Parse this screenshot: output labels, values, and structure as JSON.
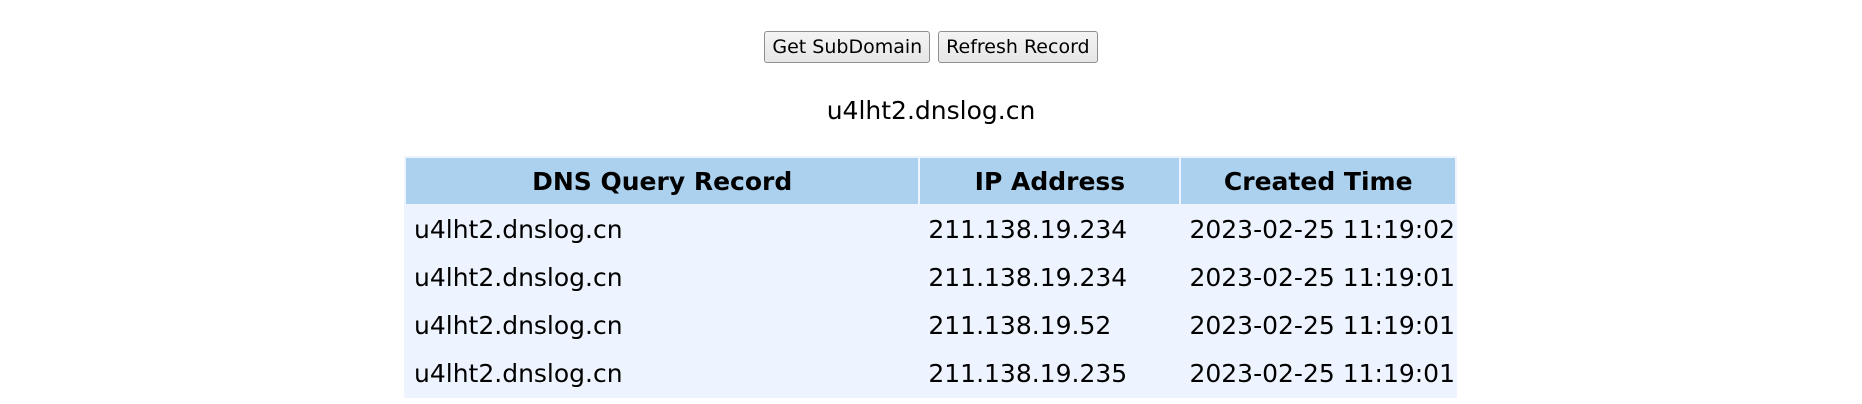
{
  "toolbar": {
    "get_subdomain_label": "Get SubDomain",
    "refresh_record_label": "Refresh Record"
  },
  "subdomain": "u4lht2.dnslog.cn",
  "table": {
    "headers": [
      "DNS Query Record",
      "IP Address",
      "Created Time"
    ],
    "rows": [
      [
        "u4lht2.dnslog.cn",
        "211.138.19.234",
        "2023-02-25 11:19:02"
      ],
      [
        "u4lht2.dnslog.cn",
        "211.138.19.234",
        "2023-02-25 11:19:01"
      ],
      [
        "u4lht2.dnslog.cn",
        "211.138.19.52",
        "2023-02-25 11:19:01"
      ],
      [
        "u4lht2.dnslog.cn",
        "211.138.19.235",
        "2023-02-25 11:19:01"
      ]
    ]
  },
  "colors": {
    "header_bg": "#abd1ee",
    "table_bg": "#eef4ff"
  }
}
